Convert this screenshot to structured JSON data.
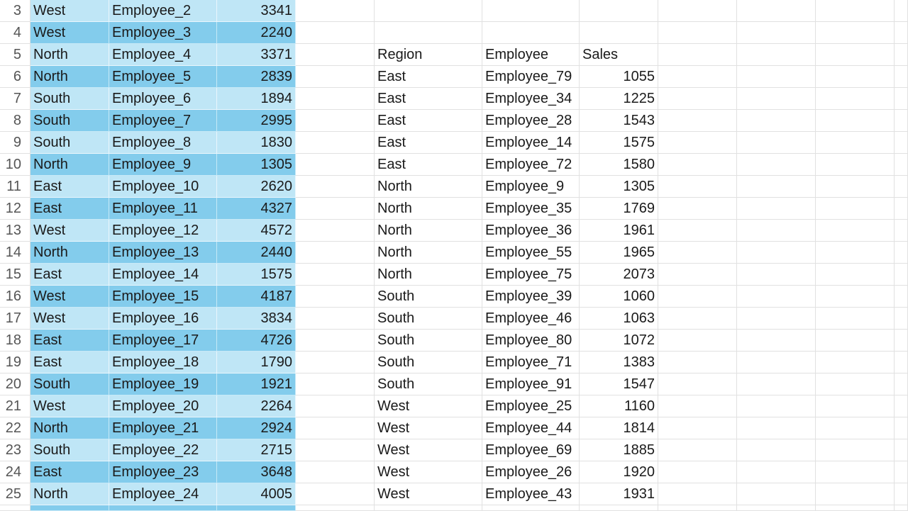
{
  "colors": {
    "band_light": "#bfe6f6",
    "band_dark": "#83ccec",
    "gridline": "#e1e1e1"
  },
  "left_table": {
    "rows": [
      {
        "row": "3",
        "region": "West",
        "employee": "Employee_2",
        "sales": "3341"
      },
      {
        "row": "4",
        "region": "West",
        "employee": "Employee_3",
        "sales": "2240"
      },
      {
        "row": "5",
        "region": "North",
        "employee": "Employee_4",
        "sales": "3371"
      },
      {
        "row": "6",
        "region": "North",
        "employee": "Employee_5",
        "sales": "2839"
      },
      {
        "row": "7",
        "region": "South",
        "employee": "Employee_6",
        "sales": "1894"
      },
      {
        "row": "8",
        "region": "South",
        "employee": "Employee_7",
        "sales": "2995"
      },
      {
        "row": "9",
        "region": "South",
        "employee": "Employee_8",
        "sales": "1830"
      },
      {
        "row": "10",
        "region": "North",
        "employee": "Employee_9",
        "sales": "1305"
      },
      {
        "row": "11",
        "region": "East",
        "employee": "Employee_10",
        "sales": "2620"
      },
      {
        "row": "12",
        "region": "East",
        "employee": "Employee_11",
        "sales": "4327"
      },
      {
        "row": "13",
        "region": "West",
        "employee": "Employee_12",
        "sales": "4572"
      },
      {
        "row": "14",
        "region": "North",
        "employee": "Employee_13",
        "sales": "2440"
      },
      {
        "row": "15",
        "region": "East",
        "employee": "Employee_14",
        "sales": "1575"
      },
      {
        "row": "16",
        "region": "West",
        "employee": "Employee_15",
        "sales": "4187"
      },
      {
        "row": "17",
        "region": "West",
        "employee": "Employee_16",
        "sales": "3834"
      },
      {
        "row": "18",
        "region": "East",
        "employee": "Employee_17",
        "sales": "4726"
      },
      {
        "row": "19",
        "region": "East",
        "employee": "Employee_18",
        "sales": "1790"
      },
      {
        "row": "20",
        "region": "South",
        "employee": "Employee_19",
        "sales": "1921"
      },
      {
        "row": "21",
        "region": "West",
        "employee": "Employee_20",
        "sales": "2264"
      },
      {
        "row": "22",
        "region": "North",
        "employee": "Employee_21",
        "sales": "2924"
      },
      {
        "row": "23",
        "region": "South",
        "employee": "Employee_22",
        "sales": "2715"
      },
      {
        "row": "24",
        "region": "East",
        "employee": "Employee_23",
        "sales": "3648"
      },
      {
        "row": "25",
        "region": "North",
        "employee": "Employee_24",
        "sales": "4005"
      }
    ]
  },
  "right_table": {
    "headers": {
      "region": "Region",
      "employee": "Employee",
      "sales": "Sales"
    },
    "rows": [
      {
        "region": "East",
        "employee": "Employee_79",
        "sales": "1055"
      },
      {
        "region": "East",
        "employee": "Employee_34",
        "sales": "1225"
      },
      {
        "region": "East",
        "employee": "Employee_28",
        "sales": "1543"
      },
      {
        "region": "East",
        "employee": "Employee_14",
        "sales": "1575"
      },
      {
        "region": "East",
        "employee": "Employee_72",
        "sales": "1580"
      },
      {
        "region": "North",
        "employee": "Employee_9",
        "sales": "1305"
      },
      {
        "region": "North",
        "employee": "Employee_35",
        "sales": "1769"
      },
      {
        "region": "North",
        "employee": "Employee_36",
        "sales": "1961"
      },
      {
        "region": "North",
        "employee": "Employee_55",
        "sales": "1965"
      },
      {
        "region": "North",
        "employee": "Employee_75",
        "sales": "2073"
      },
      {
        "region": "South",
        "employee": "Employee_39",
        "sales": "1060"
      },
      {
        "region": "South",
        "employee": "Employee_46",
        "sales": "1063"
      },
      {
        "region": "South",
        "employee": "Employee_80",
        "sales": "1072"
      },
      {
        "region": "South",
        "employee": "Employee_71",
        "sales": "1383"
      },
      {
        "region": "South",
        "employee": "Employee_91",
        "sales": "1547"
      },
      {
        "region": "West",
        "employee": "Employee_25",
        "sales": "1160"
      },
      {
        "region": "West",
        "employee": "Employee_44",
        "sales": "1814"
      },
      {
        "region": "West",
        "employee": "Employee_69",
        "sales": "1885"
      },
      {
        "region": "West",
        "employee": "Employee_26",
        "sales": "1920"
      },
      {
        "region": "West",
        "employee": "Employee_43",
        "sales": "1931"
      }
    ]
  }
}
